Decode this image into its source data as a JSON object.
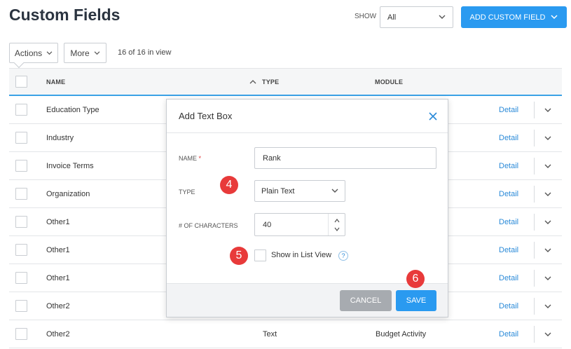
{
  "header": {
    "title": "Custom Fields",
    "show_label": "SHOW",
    "show_value": "All",
    "add_button": "ADD CUSTOM FIELD"
  },
  "toolbar": {
    "actions_label": "Actions",
    "more_label": "More",
    "in_view": "16 of 16 in view"
  },
  "table": {
    "columns": {
      "name": "NAME",
      "type": "TYPE",
      "module": "MODULE"
    },
    "detail_label": "Detail",
    "rows": [
      {
        "name": "Education Type",
        "type": "",
        "module": ""
      },
      {
        "name": "Industry",
        "type": "",
        "module": ""
      },
      {
        "name": "Invoice Terms",
        "type": "",
        "module": ""
      },
      {
        "name": "Organization",
        "type": "",
        "module": ""
      },
      {
        "name": "Other1",
        "type": "",
        "module": ""
      },
      {
        "name": "Other1",
        "type": "",
        "module": ""
      },
      {
        "name": "Other1",
        "type": "",
        "module": ""
      },
      {
        "name": "Other2",
        "type": "",
        "module": ""
      },
      {
        "name": "Other2",
        "type": "Text",
        "module": "Budget Activity"
      }
    ]
  },
  "modal": {
    "title": "Add Text Box",
    "name_label": "NAME",
    "required_mark": "*",
    "name_value": "Rank",
    "type_label": "TYPE",
    "type_value": "Plain Text",
    "chars_label": "# OF CHARACTERS",
    "chars_value": "40",
    "list_view_label": "Show in List View",
    "help_glyph": "?",
    "cancel_label": "CANCEL",
    "save_label": "SAVE"
  },
  "markers": {
    "m4": "4",
    "m5": "5",
    "m6": "6"
  },
  "colors": {
    "primary": "#2a9af0",
    "marker": "#e83a3a",
    "cancel": "#a7abb0",
    "link": "#2a8ad8"
  }
}
